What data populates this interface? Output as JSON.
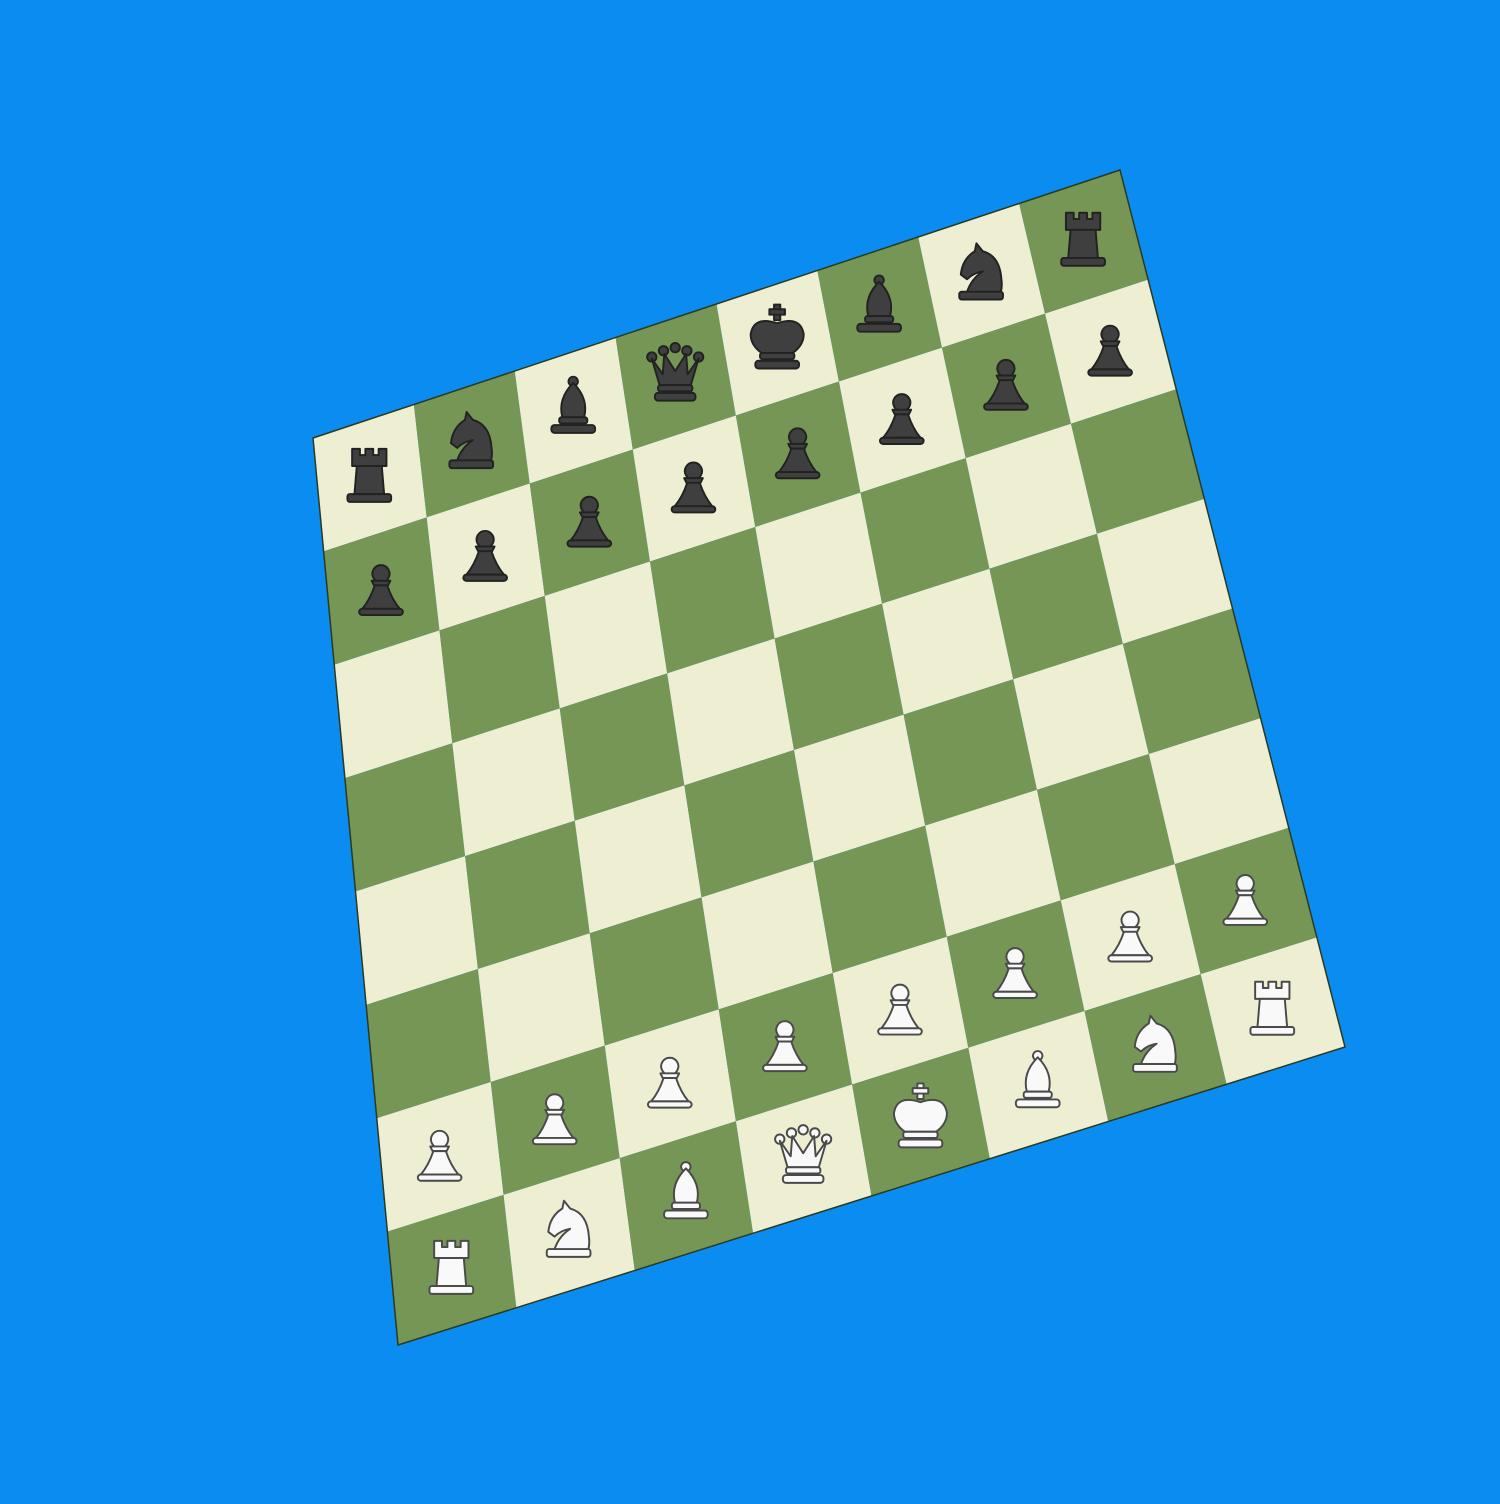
{
  "board": {
    "light_color": "#eeeed2",
    "dark_color": "#769656",
    "rows": [
      [
        "r",
        "n",
        "b",
        "q",
        "k",
        "b",
        "n",
        "r"
      ],
      [
        "p",
        "p",
        "p",
        "p",
        "p",
        "p",
        "p",
        "p"
      ],
      [
        "",
        "",
        "",
        "",
        "",
        "",
        "",
        ""
      ],
      [
        "",
        "",
        "",
        "",
        "",
        "",
        "",
        ""
      ],
      [
        "",
        "",
        "",
        "",
        "",
        "",
        "",
        ""
      ],
      [
        "",
        "",
        "",
        "",
        "",
        "",
        "",
        ""
      ],
      [
        "P",
        "P",
        "P",
        "P",
        "P",
        "P",
        "P",
        "P"
      ],
      [
        "R",
        "N",
        "B",
        "Q",
        "K",
        "B",
        "N",
        "R"
      ]
    ]
  },
  "piece_names": {
    "k": "king",
    "q": "queen",
    "r": "rook",
    "b": "bishop",
    "n": "knight",
    "p": "pawn"
  },
  "colors": {
    "background": "#0a8cf0",
    "white_piece_fill": "#f9f9f9",
    "black_piece_fill": "#3f3f3f"
  }
}
